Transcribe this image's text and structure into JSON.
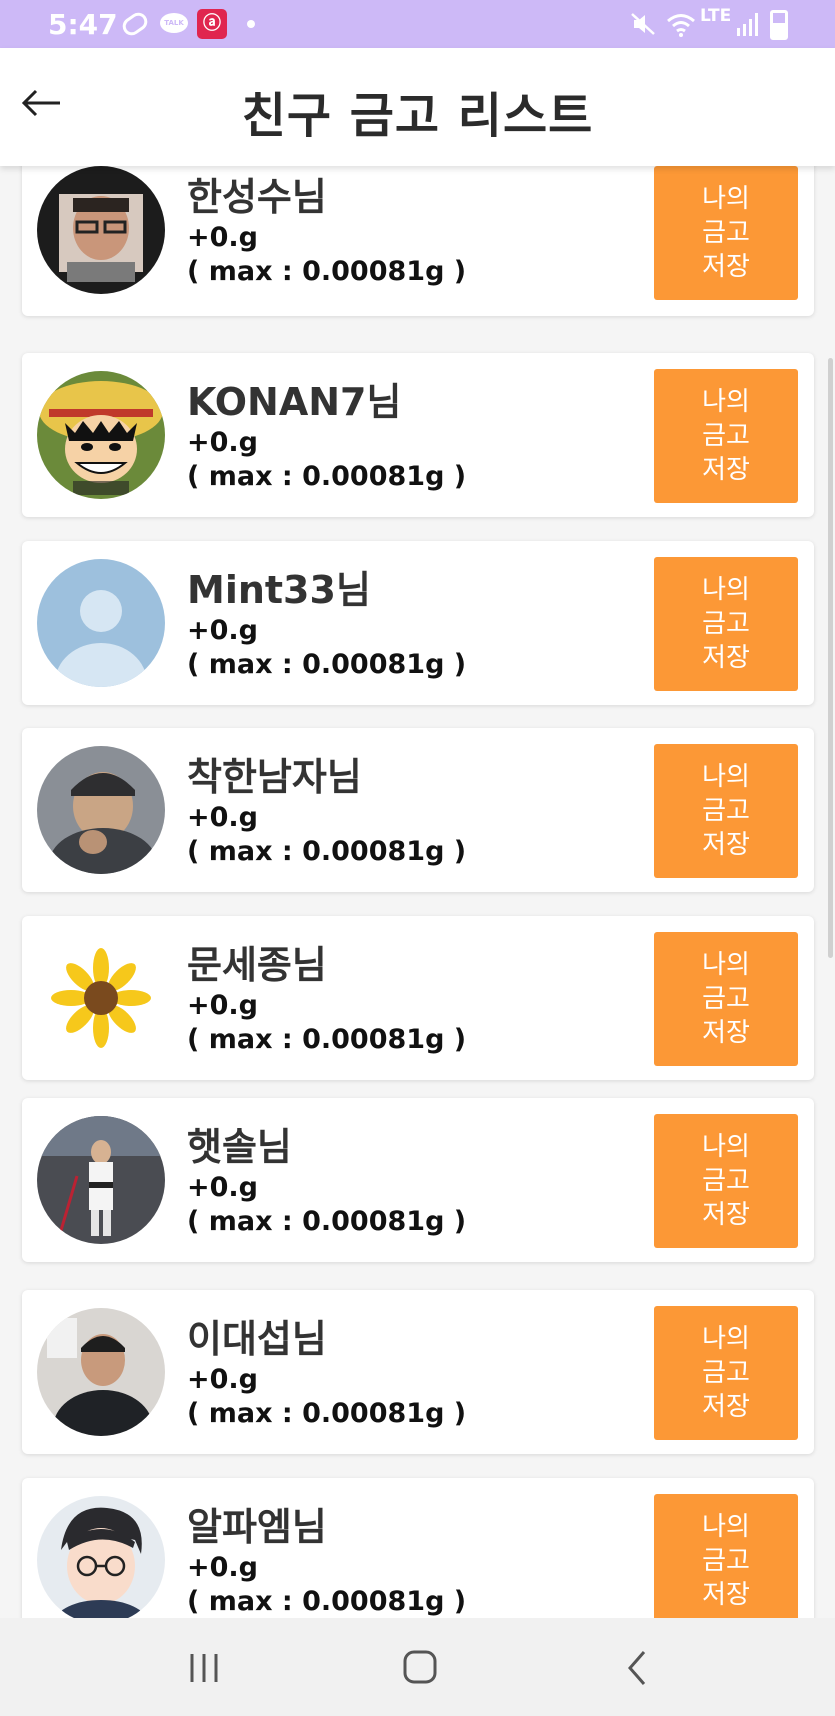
{
  "status_bar": {
    "time": "5:47",
    "talk_label": "TALK",
    "network": "LTE",
    "icons": [
      "pill-icon",
      "talk-icon",
      "app-icon",
      "dot-icon",
      "mute-icon",
      "wifi-icon",
      "signal-icon",
      "battery-icon"
    ]
  },
  "header": {
    "title": "친구 금고 리스트",
    "back_icon": "arrow-left-icon"
  },
  "friends": [
    {
      "name": "한성수님",
      "amount": "+0.g",
      "max": "( max : 0.00081g )",
      "button": [
        "나의",
        "금고",
        "저장"
      ],
      "avatar": "man-glasses-photo"
    },
    {
      "name": "KONAN7님",
      "amount": "+0.g",
      "max": "( max : 0.00081g )",
      "button": [
        "나의",
        "금고",
        "저장"
      ],
      "avatar": "cartoon-straw-hat"
    },
    {
      "name": "Mint33님",
      "amount": "+0.g",
      "max": "( max : 0.00081g )",
      "button": [
        "나의",
        "금고",
        "저장"
      ],
      "avatar": "default-profile"
    },
    {
      "name": "착한남자님",
      "amount": "+0.g",
      "max": "( max : 0.00081g )",
      "button": [
        "나의",
        "금고",
        "저장"
      ],
      "avatar": "man-cap-photo"
    },
    {
      "name": "문세종님",
      "amount": "+0.g",
      "max": "( max : 0.00081g )",
      "button": [
        "나의",
        "금고",
        "저장"
      ],
      "avatar": "sunflower"
    },
    {
      "name": "햇솔님",
      "amount": "+0.g",
      "max": "( max : 0.00081g )",
      "button": [
        "나의",
        "금고",
        "저장"
      ],
      "avatar": "child-taekwondo-photo"
    },
    {
      "name": "이대섭님",
      "amount": "+0.g",
      "max": "( max : 0.00081g )",
      "button": [
        "나의",
        "금고",
        "저장"
      ],
      "avatar": "man-selfie-photo"
    },
    {
      "name": "알파엠님",
      "amount": "+0.g",
      "max": "( max : 0.00081g )",
      "button": [
        "나의",
        "금고",
        "저장"
      ],
      "avatar": "cartoon-glasses-boy"
    }
  ],
  "nav_bar": {
    "buttons": [
      "recent-apps-icon",
      "home-icon",
      "back-icon"
    ]
  },
  "colors": {
    "status_bar": "#cdb9f7",
    "button": "#fc9836",
    "card": "#ffffff",
    "background": "#f5f5f5"
  }
}
